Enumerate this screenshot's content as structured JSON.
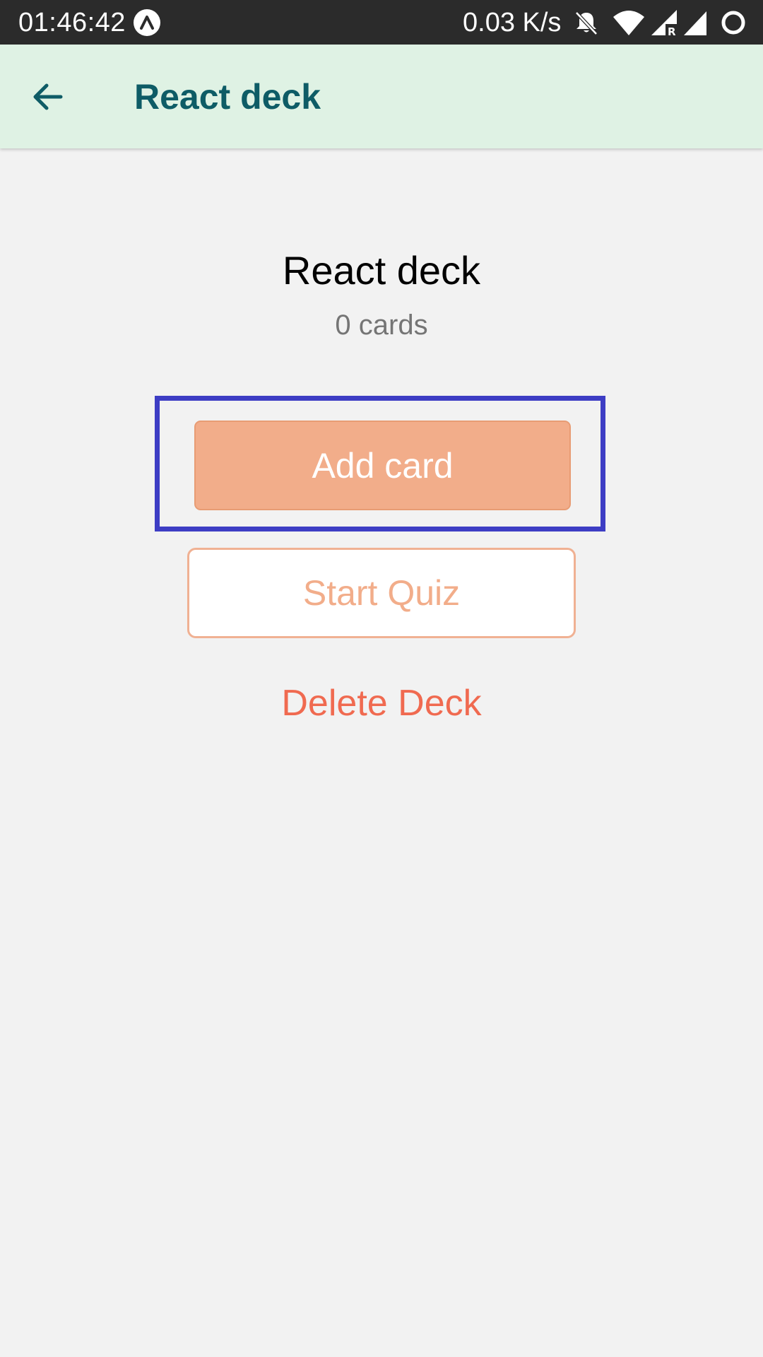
{
  "status_bar": {
    "time": "01:46:42",
    "network_speed": "0.03 K/s",
    "icons": [
      "app-notification-icon",
      "bell-off-icon",
      "wifi-icon",
      "signal-roaming-icon",
      "signal-icon",
      "battery-ring-icon"
    ]
  },
  "app_bar": {
    "back_icon": "arrow-back-icon",
    "title": "React deck"
  },
  "deck": {
    "title": "React deck",
    "card_count": "0 cards"
  },
  "actions": {
    "add_card_label": "Add card",
    "start_quiz_label": "Start Quiz",
    "delete_deck_label": "Delete Deck"
  },
  "colors": {
    "app_bar_bg": "#dff2e4",
    "title_color": "#0e5c66",
    "primary": "#f2ad8a",
    "danger": "#f06a50",
    "highlight": "#3d3dc4"
  }
}
